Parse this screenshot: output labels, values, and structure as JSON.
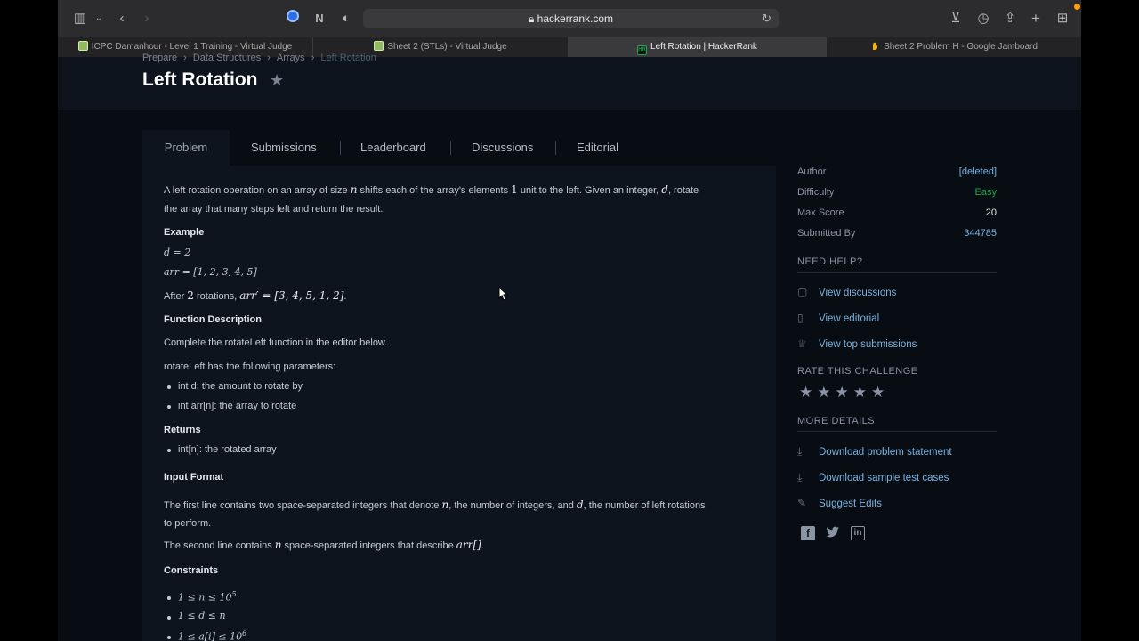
{
  "browser": {
    "url": "hackerrank.com",
    "tabs": [
      {
        "label": "ICPC Damanhour - Level 1 Training - Virtual Judge",
        "favicon": "vjudge-icon"
      },
      {
        "label": "Sheet 2 (STLs) - Virtual Judge",
        "favicon": "vjudge-icon"
      },
      {
        "label": "Left Rotation | HackerRank",
        "favicon": "hackerrank-icon",
        "active": true
      },
      {
        "label": "Sheet 2 Problem H - Google Jamboard",
        "favicon": "jamboard-icon"
      }
    ],
    "hackerrank_favicon_text": "HR"
  },
  "breadcrumb": [
    "Prepare",
    "Data Structures",
    "Arrays",
    "Left Rotation"
  ],
  "page_title": "Left Rotation",
  "nav_tabs": [
    "Problem",
    "Submissions",
    "Leaderboard",
    "Discussions",
    "Editorial"
  ],
  "problem": {
    "intro_1a": "A left rotation operation on an array of size ",
    "intro_n": "n",
    "intro_1b": " shifts each of the array's elements ",
    "intro_1": "1",
    "intro_1c": " unit to the left. Given an integer, ",
    "intro_d": "d",
    "intro_1d": ", rotate",
    "intro_2": "the array that many steps left and return the result.",
    "example_head": "Example",
    "ex_d": "d = 2",
    "ex_arr": "arr = [1, 2, 3, 4, 5]",
    "after_a": "After ",
    "after_2": "2",
    "after_b": " rotations, ",
    "after_math": "arr′ = [3, 4, 5, 1, 2]",
    "after_c": ".",
    "func_head": "Function Description",
    "func_text": "Complete the rotateLeft function in the editor below.",
    "params_intro": "rotateLeft has the following parameters:",
    "param_1": "int d: the amount to rotate by",
    "param_2": "int arr[n]: the array to rotate",
    "returns_head": "Returns",
    "returns_1": "int[n]: the rotated array",
    "input_head": "Input Format",
    "input_1a": "The first line contains two space-separated integers that denote ",
    "input_n": "n",
    "input_1b": ", the number of integers, and ",
    "input_d": "d",
    "input_1c": ", the number of left rotations",
    "input_2": "to perform.",
    "input_3a": "The second line contains ",
    "input_3n": "n",
    "input_3b": " space-separated integers that describe ",
    "input_3arr": "arr[]",
    "input_3c": ".",
    "constraints_head": "Constraints",
    "c1": "1 ≤ n ≤ 10",
    "c1_sup": "5",
    "c2": "1 ≤ d ≤ n",
    "c3": "1 ≤ a[i] ≤ 10",
    "c3_sup": "6"
  },
  "sidebar": {
    "author_label": "Author",
    "author_value": "[deleted]",
    "difficulty_label": "Difficulty",
    "difficulty_value": "Easy",
    "maxscore_label": "Max Score",
    "maxscore_value": "20",
    "submitted_label": "Submitted By",
    "submitted_value": "344785",
    "need_help": "NEED HELP?",
    "help_links": [
      "View discussions",
      "View editorial",
      "View top submissions"
    ],
    "rate_head": "RATE THIS CHALLENGE",
    "rating_stars": 5,
    "more_head": "MORE DETAILS",
    "more_links": [
      "Download problem statement",
      "Download sample test cases",
      "Suggest Edits"
    ]
  },
  "colors": {
    "easy": "#1ba94c",
    "link": "#7bb3e0",
    "accent_active_tab": "#3a3a3c"
  }
}
